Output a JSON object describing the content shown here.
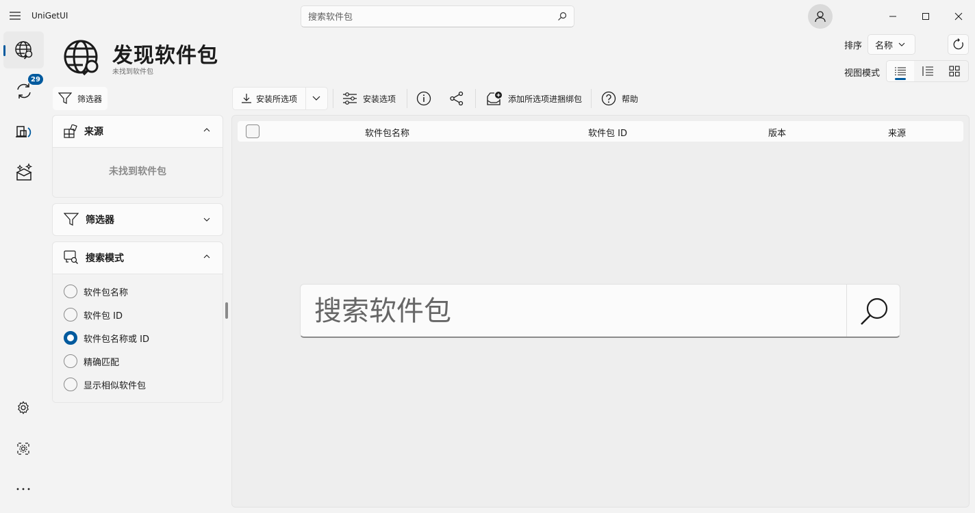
{
  "app": {
    "title": "UniGetUI"
  },
  "top_search": {
    "placeholder": "搜索软件包"
  },
  "nav": {
    "updates_badge": "29",
    "items": [
      {
        "name": "discover",
        "icon": "globe-search-icon"
      },
      {
        "name": "updates",
        "icon": "sync-icon"
      },
      {
        "name": "installed",
        "icon": "installed-packages-icon"
      },
      {
        "name": "bundles",
        "icon": "box-sparkle-icon"
      }
    ],
    "bottom": [
      {
        "name": "settings",
        "icon": "gear-icon"
      },
      {
        "name": "managers",
        "icon": "manager-gear-icon"
      },
      {
        "name": "more",
        "icon": "more-icon"
      }
    ]
  },
  "header": {
    "title": "发现软件包",
    "subtitle": "未找到软件包",
    "sort_label": "排序",
    "sort_value": "名称",
    "view_label": "视图模式"
  },
  "filter_button": {
    "label": "筛选器"
  },
  "toolbar": {
    "install_selected": "安装所选项",
    "install_options": "安装选项",
    "add_to_bundle": "添加所选项进捆绑包",
    "help": "帮助"
  },
  "panels": {
    "sources": {
      "title": "来源",
      "empty": "未找到软件包"
    },
    "filters": {
      "title": "筛选器"
    },
    "search_mode": {
      "title": "搜索模式",
      "options": [
        "软件包名称",
        "软件包 ID",
        "软件包名称或 ID",
        "精确匹配",
        "显示相似软件包"
      ],
      "selected": 2
    }
  },
  "table": {
    "columns": {
      "name": "软件包名称",
      "id": "软件包 ID",
      "version": "版本",
      "source": "来源"
    }
  },
  "big_search": {
    "placeholder": "搜索软件包"
  },
  "colors": {
    "accent": "#005a9e",
    "background": "#f3f3f3"
  }
}
